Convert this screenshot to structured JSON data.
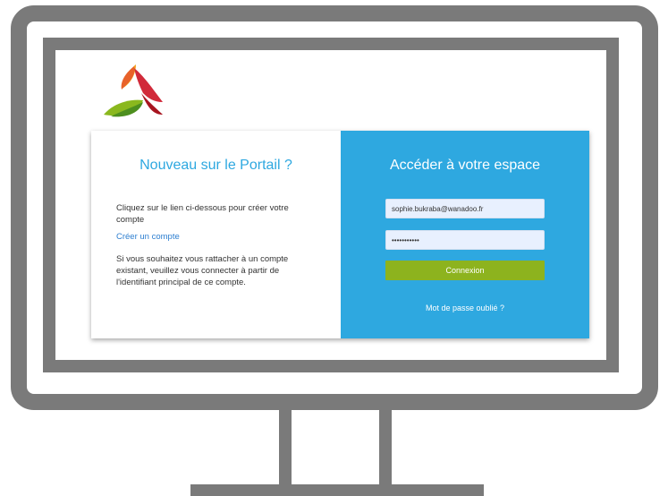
{
  "left": {
    "title": "Nouveau sur le Portail ?",
    "text1": "Cliquez sur le lien ci-dessous pour créer votre compte",
    "link": "Créer un compte",
    "text2": "Si vous souhaitez vous rattacher à un compte existant, veuillez vous connecter à partir de l'identifiant principal de ce compte."
  },
  "right": {
    "title": "Accéder à votre espace",
    "email_value": "sophie.bukraba@wanadoo.fr",
    "password_value": "•••••••••••",
    "login_button": "Connexion",
    "forgot_link": "Mot de passe oublié ?"
  },
  "colors": {
    "accent_blue": "#2ea8e0",
    "button_green": "#8db31e",
    "frame_gray": "#7a7a7a"
  },
  "icons": {
    "logo": "tri-color-swoosh-logo"
  }
}
